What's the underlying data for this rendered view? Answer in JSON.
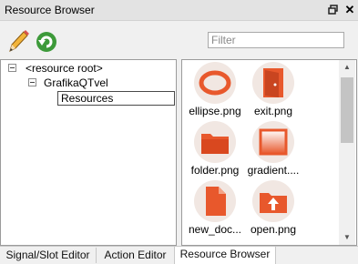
{
  "window": {
    "title": "Resource Browser",
    "float_icon": "float-icon",
    "close_icon": "close-icon",
    "close_glyph": "✕"
  },
  "toolbar": {
    "edit_icon": "pencil-icon",
    "reload_icon": "reload-icon",
    "filter_placeholder": "Filter",
    "filter_value": ""
  },
  "tree": {
    "items": [
      {
        "label": "<resource root>",
        "expanded": true
      },
      {
        "label": "GrafikaQTvel",
        "expanded": true
      },
      {
        "label": "Resources",
        "selected": true
      }
    ]
  },
  "files": [
    {
      "label": "ellipse.png",
      "icon": "ellipse-icon"
    },
    {
      "label": "exit.png",
      "icon": "exit-door-icon"
    },
    {
      "label": "folder.png",
      "icon": "folder-icon"
    },
    {
      "label": "gradient....",
      "icon": "gradient-icon"
    },
    {
      "label": "new_doc...",
      "icon": "new-document-icon"
    },
    {
      "label": "open.png",
      "icon": "open-folder-icon"
    }
  ],
  "scrollbar": {
    "up_arrow": "▲",
    "down_arrow": "▼"
  },
  "tabs": [
    {
      "label": "Signal/Slot Editor",
      "active": false
    },
    {
      "label": "Action Editor",
      "active": false
    },
    {
      "label": "Resource Browser",
      "active": true
    }
  ],
  "colors": {
    "accent": "#e8582c",
    "icon_bg": "#f1e7e2"
  }
}
